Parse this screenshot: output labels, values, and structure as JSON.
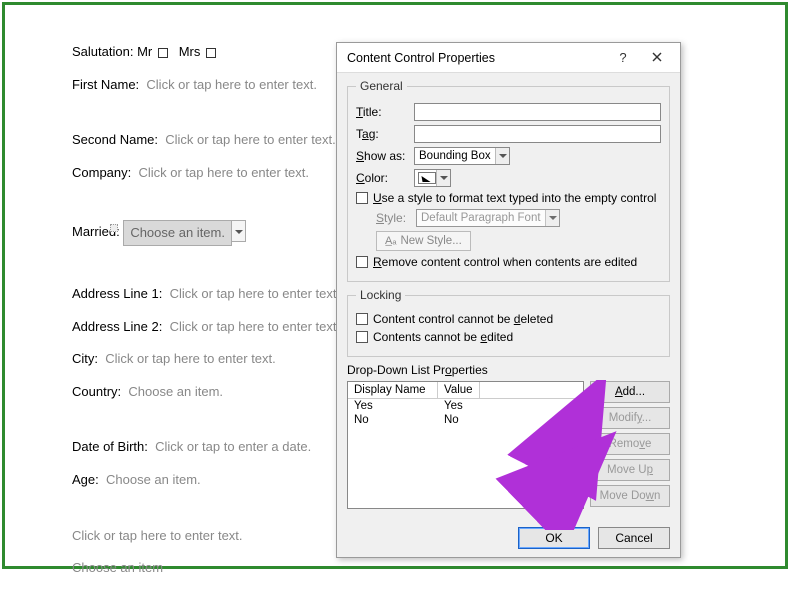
{
  "doc": {
    "salutation_label": "Salutation:",
    "salutation_mr": "Mr",
    "salutation_mrs": "Mrs",
    "first_name_label": "First Name:",
    "first_name_placeholder": "Click or tap here to enter text.",
    "second_name_label": "Second Name:",
    "second_name_placeholder": "Click or tap here to enter text.",
    "company_label": "Company:",
    "company_placeholder": "Click or tap here to enter text.",
    "married_label": "Married:",
    "married_dropdown": "Choose an item.",
    "addr1_label": "Address Line 1:",
    "addr1_placeholder": "Click or tap here to enter text.",
    "addr2_label": "Address Line 2:",
    "addr2_placeholder": "Click or tap here to enter text.",
    "city_label": "City:",
    "city_placeholder": "Click or tap here to enter text.",
    "country_label": "Country:",
    "country_placeholder": "Choose an item.",
    "dob_label": "Date of Birth:",
    "dob_placeholder": "Click or tap to enter a date.",
    "age_label": "Age:",
    "age_placeholder": "Choose an item.",
    "extra_text": "Click or tap here to enter text.",
    "extra_choose": "Choose an item"
  },
  "dialog": {
    "title": "Content Control Properties",
    "help": "?",
    "general_legend": "General",
    "title_label": "Title:",
    "tag_label": "Tag:",
    "showas_label": "Show as:",
    "showas_value": "Bounding Box",
    "color_label": "Color:",
    "use_style": "Use a style to format text typed into the empty control",
    "style_label": "Style:",
    "style_value": "Default Paragraph Font",
    "new_style": "New Style...",
    "remove_on_edit": "Remove content control when contents are edited",
    "locking_legend": "Locking",
    "lock_del": "Content control cannot be deleted",
    "lock_edit": "Contents cannot be edited",
    "dd_legend": "Drop-Down List Properties",
    "col_display": "Display Name",
    "col_value": "Value",
    "rows": [
      {
        "display": "Yes",
        "value": "Yes"
      },
      {
        "display": "No",
        "value": "No"
      }
    ],
    "btn_add": "Add...",
    "btn_modify": "Modify...",
    "btn_remove": "Remove",
    "btn_moveup": "Move Up",
    "btn_movedown": "Move Down",
    "btn_ok": "OK",
    "btn_cancel": "Cancel"
  }
}
